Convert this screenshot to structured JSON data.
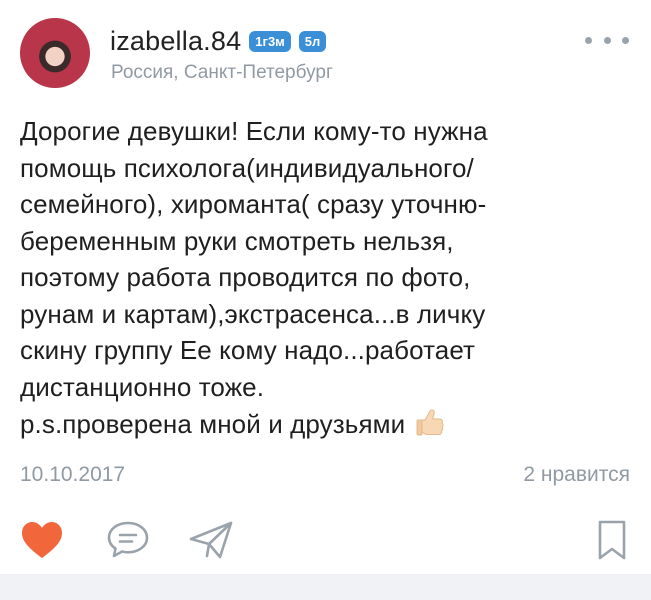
{
  "post": {
    "username": "izabella.84",
    "badges": [
      "1г3м",
      "5л"
    ],
    "location": "Россия, Санкт-Петербург",
    "text": "Дорогие девушки! Если кому-то нужна\nпомощь психолога(индивидуального/\nсемейного), хироманта( сразу уточню-\nбеременным руки смотреть нельзя,\nпоэтому работа проводится по фото,\nрунам и картам),экстрасенса...в личку\nскину группу Ее кому надо...работает\nдистанционно тоже.\np.s.проверена мной и друзьями",
    "date": "10.10.2017",
    "likes": "2 нравится"
  },
  "icons": {
    "more": "more-dots-icon",
    "thumb": "thumbs-up-icon",
    "like": "heart-icon",
    "comment": "comment-icon",
    "share": "send-icon",
    "bookmark": "bookmark-icon"
  },
  "colors": {
    "badge": "#3b8fd6",
    "like_active": "#f2663c",
    "icon_gray": "#9aa3ab",
    "meta_text": "#909aa3"
  }
}
